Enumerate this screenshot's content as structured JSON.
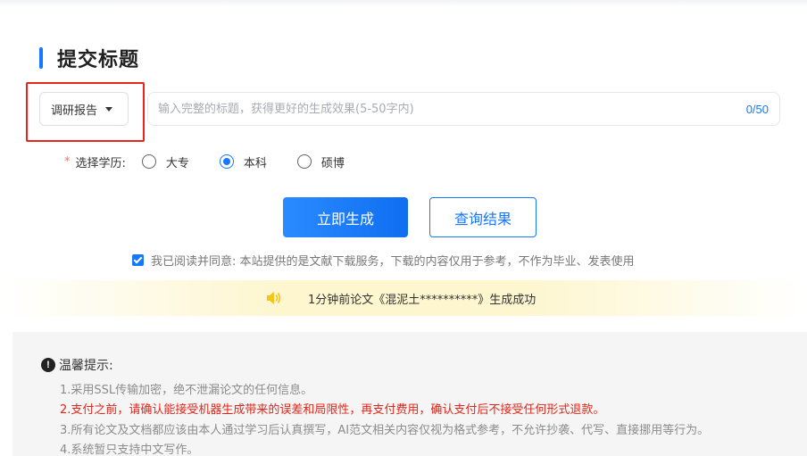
{
  "page": {
    "section_title": "提交标题"
  },
  "type_select": {
    "value": "调研报告"
  },
  "title_input": {
    "placeholder": "输入完整的标题，获得更好的生成效果(5-50字内)",
    "value": "",
    "count": "0/50"
  },
  "education": {
    "required_mark": "*",
    "label": "选择学历:",
    "options": [
      {
        "label": "大专",
        "checked": false
      },
      {
        "label": "本科",
        "checked": true
      },
      {
        "label": "硕博",
        "checked": false
      }
    ]
  },
  "actions": {
    "generate_label": "立即生成",
    "query_label": "查询结果"
  },
  "agreement": {
    "checked": true,
    "text": "我已阅读并同意: 本站提供的是文献下载服务，下载的内容仅用于参考，不作为毕业、发表使用"
  },
  "notice": {
    "icon": "speaker-icon",
    "text": "1分钟前论文《混泥土**********》生成成功"
  },
  "tips": {
    "heading": "温馨提示:",
    "lines": [
      {
        "text": "1.采用SSL传输加密，绝不泄漏论文的任何信息。",
        "highlight": false
      },
      {
        "text": "2.支付之前，请确认能接受机器生成带来的误差和局限性，再支付费用，确认支付后不接受任何形式退款。",
        "highlight": true
      },
      {
        "text": "3.所有论文及文档都应该由本人通过学习后认真撰写，AI范文相关内容仅视为格式参考，不允许抄袭、代写、直接挪用等行为。",
        "highlight": false
      },
      {
        "text": "4.系统暂只支持中文写作。",
        "highlight": false
      }
    ]
  },
  "colors": {
    "primary": "#1677ff",
    "alert_red": "#e0261b",
    "highlight_border": "#e8251c"
  }
}
